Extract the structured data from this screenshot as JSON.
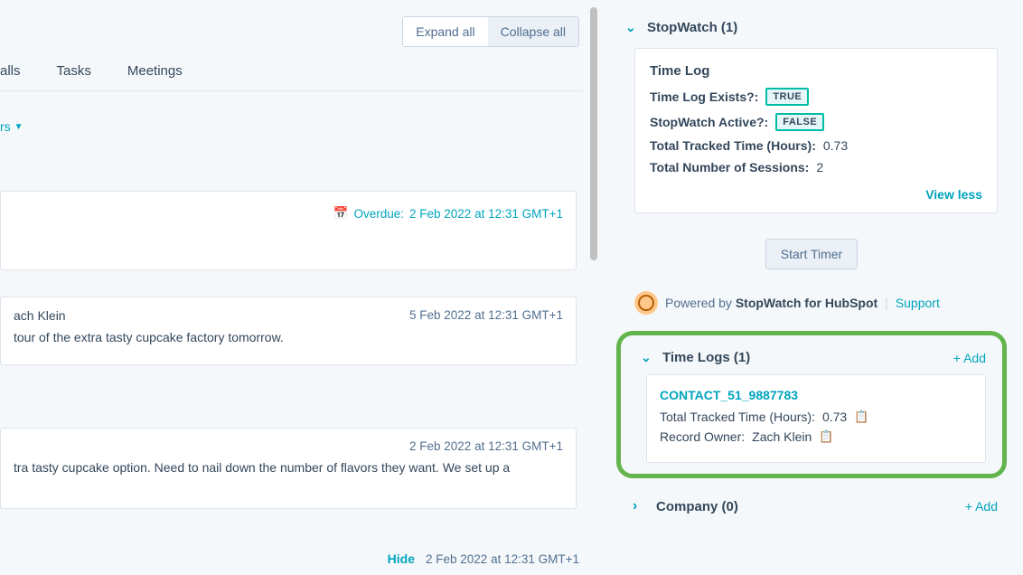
{
  "toolbar": {
    "expand_all": "Expand all",
    "collapse_all": "Collapse all"
  },
  "tabs": {
    "calls": "alls",
    "tasks": "Tasks",
    "meetings": "Meetings"
  },
  "filters_label": "rs",
  "overdue": {
    "prefix": "Overdue:",
    "date": "2 Feb 2022 at 12:31 GMT+1"
  },
  "activity2": {
    "name": "ach Klein",
    "date": "5 Feb 2022 at 12:31 GMT+1",
    "body": "tour of the extra tasty cupcake factory tomorrow."
  },
  "activity3": {
    "date": "2 Feb 2022 at 12:31 GMT+1",
    "body": "tra tasty cupcake option. Need to nail down the number of flavors they want. We set up a"
  },
  "bottom": {
    "hide": "Hide",
    "date": "2 Feb 2022 at 12:31 GMT+1"
  },
  "stopwatch": {
    "section_title": "StopWatch (1)",
    "card_title": "Time Log",
    "exists_label": "Time Log Exists?:",
    "exists_value": "TRUE",
    "active_label": "StopWatch Active?:",
    "active_value": "FALSE",
    "total_time_label": "Total Tracked Time (Hours):",
    "total_time_value": "0.73",
    "sessions_label": "Total Number of Sessions:",
    "sessions_value": "2",
    "view_less": "View less",
    "start_timer": "Start Timer",
    "powered_prefix": "Powered by",
    "powered_name": "StopWatch for HubSpot",
    "support": "Support"
  },
  "timelogs": {
    "section_title": "Time Logs (1)",
    "add": "+ Add",
    "record_id": "CONTACT_51_9887783",
    "time_label": "Total Tracked Time (Hours):",
    "time_value": "0.73",
    "owner_label": "Record Owner:",
    "owner_value": "Zach Klein"
  },
  "company": {
    "section_title": "Company (0)",
    "add": "+ Add"
  }
}
